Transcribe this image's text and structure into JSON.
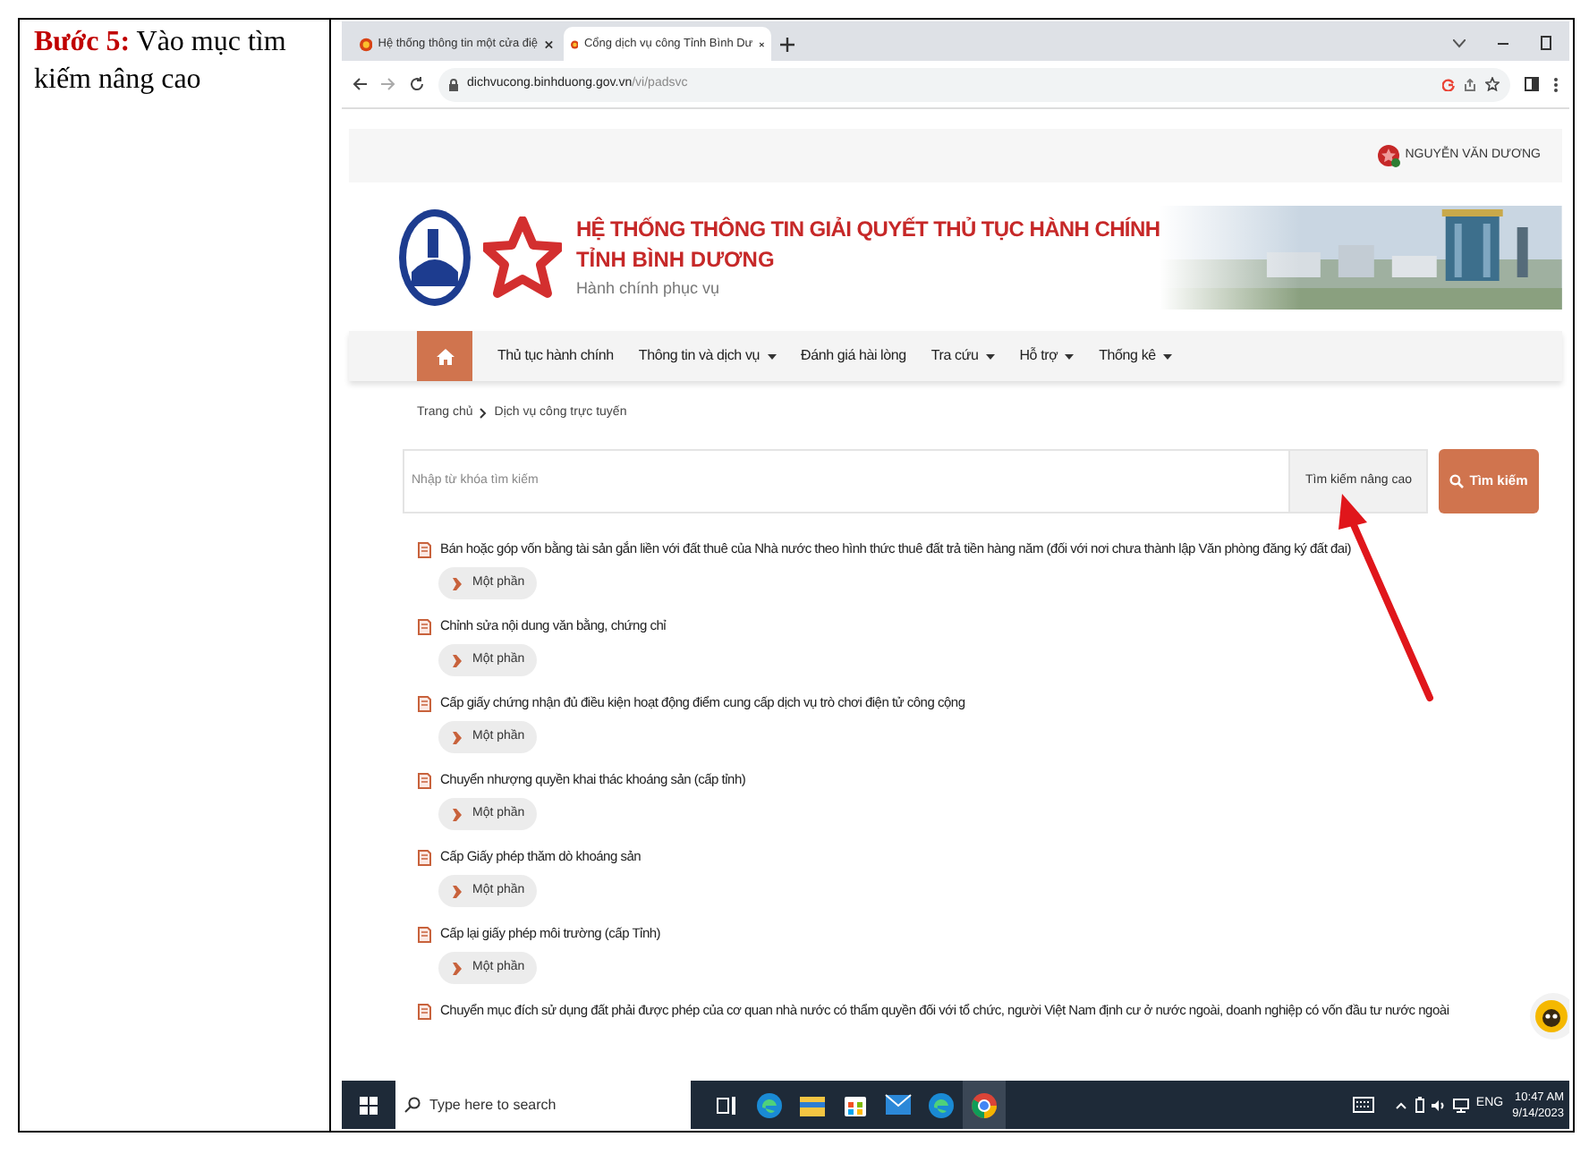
{
  "step": {
    "text": "**Bước 5:** Vào mục tìm kiếm nâng cao"
  },
  "browser": {
    "tabs": [
      {
        "title": "Hệ thống thông tin một cửa điệ",
        "selected": false
      },
      {
        "title": "Cổng dịch vụ công Tỉnh Bình Dư",
        "selected": true
      }
    ],
    "url_host": "dichvucong.binhduong.gov.vn",
    "url_path": "/vi/padsvc"
  },
  "page": {
    "user": "NGUYỄN VĂN DƯƠNG",
    "title_line1": "HỆ THỐNG THÔNG TIN GIẢI QUYẾT THỦ TỤC HÀNH CHÍNH",
    "title_line2": "TỈNH BÌNH DƯƠNG",
    "slogan": "Hành chính phục vụ",
    "nav": [
      {
        "label": "Thủ tục hành chính",
        "dropdown": false
      },
      {
        "label": "Thông tin và dịch vụ",
        "dropdown": true
      },
      {
        "label": "Đánh giá hài lòng",
        "dropdown": false
      },
      {
        "label": "Tra cứu",
        "dropdown": true
      },
      {
        "label": "Hỗ trợ",
        "dropdown": true
      },
      {
        "label": "Thống kê",
        "dropdown": true
      }
    ],
    "breadcrumb": [
      "Trang chủ",
      "Dịch vụ công trực tuyến"
    ],
    "search": {
      "placeholder": "Nhập từ khóa tìm kiếm",
      "advanced": "Tìm kiếm nâng cao",
      "button": "Tìm kiếm"
    },
    "procedures": [
      {
        "title": "Bán hoặc góp vốn bằng tài sản gắn liền với đất thuê của Nhà nước theo hình thức thuê đất trả tiền hàng năm (đối với nơi chưa thành lập Văn phòng đăng ký đất đai)",
        "badge": "Một phần"
      },
      {
        "title": "Chỉnh sửa nội dung văn bằng, chứng chỉ",
        "badge": "Một phần"
      },
      {
        "title": "Cấp giấy chứng nhận đủ điều kiện hoạt động điểm cung cấp dịch vụ trò chơi điện tử công cộng",
        "badge": "Một phần"
      },
      {
        "title": "Chuyển nhượng quyền khai thác khoáng sản (cấp tỉnh)",
        "badge": "Một phần"
      },
      {
        "title": "Cấp Giấy phép thăm dò khoáng sản",
        "badge": "Một phần"
      },
      {
        "title": "Cấp lại giấy phép môi trường (cấp Tỉnh)",
        "badge": "Một phần"
      },
      {
        "title": "Chuyển mục đích sử dụng đất phải được phép của cơ quan nhà nước có thẩm quyền đối với tổ chức, người Việt Nam định cư ở nước ngoài, doanh nghiệp có vốn đầu tư nước ngoài"
      }
    ]
  },
  "taskbar": {
    "search_placeholder": "Type here to search",
    "apps": [
      {
        "kind": "taskview",
        "selected": false
      },
      {
        "kind": "edge",
        "selected": false
      },
      {
        "kind": "folder",
        "selected": false
      },
      {
        "kind": "store",
        "selected": false
      },
      {
        "kind": "mail",
        "selected": false
      },
      {
        "kind": "edge",
        "selected": false
      },
      {
        "kind": "chrome",
        "selected": true
      }
    ],
    "lang": "ENG",
    "time": "10:47 AM",
    "date": "9/14/2023"
  }
}
